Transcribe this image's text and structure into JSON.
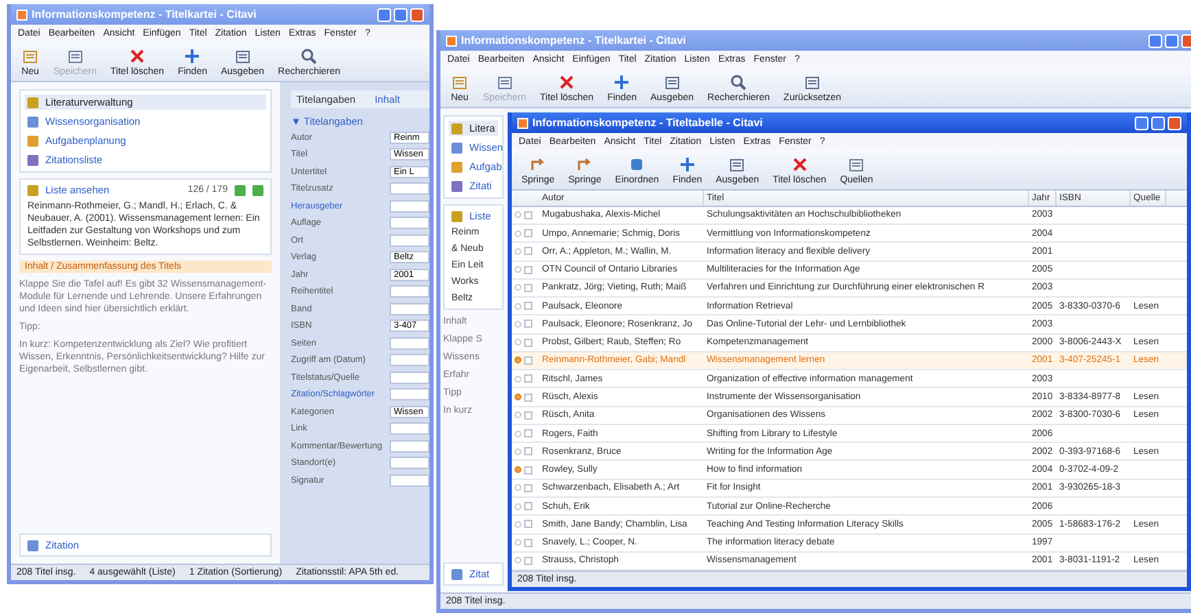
{
  "windows": [
    {
      "title": "Informationskompetenz - Titelkartei - Citavi",
      "active": false,
      "menu": [
        "Datei",
        "Bearbeiten",
        "Ansicht",
        "Einfügen",
        "Titel",
        "Zitation",
        "Listen",
        "Extras",
        "Fenster",
        "?"
      ],
      "toolbar": [
        {
          "label": "Neu",
          "kind": "new",
          "disabled": false
        },
        {
          "label": "Speichern",
          "kind": "save",
          "disabled": true
        },
        {
          "label": "Titel löschen",
          "kind": "delete",
          "disabled": false
        },
        {
          "label": "Finden",
          "kind": "find",
          "disabled": false
        },
        {
          "label": "Ausgeben",
          "kind": "output",
          "disabled": false
        },
        {
          "label": "Recherchieren",
          "kind": "search",
          "disabled": false
        }
      ],
      "nav": [
        {
          "label": "Literaturverwaltung",
          "selected": true
        },
        {
          "label": "Wissensorganisation",
          "selected": false
        },
        {
          "label": "Aufgabenplanung",
          "selected": false
        },
        {
          "label": "Zitationsliste",
          "selected": false
        }
      ],
      "list_bar": {
        "label": "Liste ansehen",
        "counter": "126 / 179"
      },
      "citation": "Reinmann-Rothmeier, G.; Mandl, H.; Erlach, C. & Neubauer, A. (2001). Wissensmanagement lernen: Ein Leitfaden zur Gestaltung von Workshops und zum Selbstlernen. Weinheim: Beltz.",
      "abstract_title": "Inhalt / Zusammenfassung des Titels",
      "abstract": "Klappe Sie die Tafel auf! Es gibt 32 Wissensmanagement-Module für Lernende und Lehrende. Unsere Erfahrungen und Ideen sind hier übersichtlich erklärt.",
      "tip": "Tipp:",
      "tip_text": "In kurz: Kompetenzentwicklung als Ziel? Wie profitiert Wissen, Erkenntnis, Persönlichkeitsentwicklung? Hilfe zur Eigenarbeit, Selbstlernen gibt.",
      "bottom_link": "Zitation",
      "details": {
        "heading": "Titelangaben",
        "link": "Inhalt",
        "group_marker": "▼",
        "group": "Titelangaben",
        "fields": [
          {
            "label": "Autor",
            "value": "Reinm",
            "link": false
          },
          {
            "label": "Titel",
            "value": "Wissen",
            "link": false
          },
          {
            "label": "Untertitel",
            "value": "Ein L",
            "link": false
          },
          {
            "label": "Titelzusatz",
            "link": false
          },
          {
            "label": "Herausgeber",
            "link": true
          },
          {
            "label": "Auflage",
            "link": false
          },
          {
            "label": "Ort",
            "link": false
          },
          {
            "label": "Verlag",
            "value": "Beltz",
            "link": false
          },
          {
            "label": "Jahr",
            "value": "2001",
            "link": false
          },
          {
            "label": "Reihentitel",
            "link": false
          },
          {
            "label": "Band",
            "link": false
          },
          {
            "label": "ISBN",
            "value": "3-407",
            "link": false
          },
          {
            "label": "Seiten",
            "link": false
          },
          {
            "label": "Zugriff am (Datum)",
            "link": false
          },
          {
            "label": "Titelstatus/Quelle",
            "link": false
          },
          {
            "label": "Zitation/Schlagwörter",
            "link": true
          },
          {
            "label": "Kategorien",
            "value": "Wissen",
            "link": false
          },
          {
            "label": "Link",
            "link": false
          },
          {
            "label": "Kommentar/Bewertung",
            "link": false
          },
          {
            "label": "Standort(e)",
            "link": false
          },
          {
            "label": "Signatur",
            "link": false
          }
        ]
      },
      "status": [
        "208 Titel insg.",
        "4 ausgewählt (Liste)",
        "1 Zitation (Sortierung)",
        "Zitationsstil: APA 5th ed."
      ]
    },
    {
      "title": "Informationskompetenz - Titelkartei - Citavi",
      "active": false,
      "menu": [
        "Datei",
        "Bearbeiten",
        "Ansicht",
        "Einfügen",
        "Titel",
        "Zitation",
        "Listen",
        "Extras",
        "Fenster",
        "?"
      ],
      "toolbar": [
        {
          "label": "Neu",
          "kind": "new",
          "disabled": false
        },
        {
          "label": "Speichern",
          "kind": "save",
          "disabled": true
        },
        {
          "label": "Titel löschen",
          "kind": "delete",
          "disabled": false
        },
        {
          "label": "Finden",
          "kind": "find",
          "disabled": false
        },
        {
          "label": "Ausgeben",
          "kind": "output",
          "disabled": false
        },
        {
          "label": "Recherchieren",
          "kind": "search",
          "disabled": false
        },
        {
          "label": "Zurücksetzen",
          "kind": "reset",
          "disabled": false
        }
      ],
      "nav": [
        {
          "label": "Litera",
          "selected": true
        },
        {
          "label": "Wissen",
          "selected": false
        },
        {
          "label": "Aufgab",
          "selected": false
        },
        {
          "label": "Zitati",
          "selected": false
        }
      ],
      "list_bar": {
        "label": "Liste"
      },
      "citation_lines": [
        "Reinm",
        "& Neub",
        "Ein Leit",
        "Works",
        "Beltz"
      ],
      "abstract_lines": [
        "Inhalt",
        "Klappe S",
        "Wissens",
        "Erfahr",
        "Tipp",
        "In kurz"
      ],
      "bottom_link": "Zitat",
      "status": [
        "208 Titel insg."
      ]
    },
    {
      "title": "Informationskompetenz - Titeltabelle - Citavi",
      "active": true,
      "menu": [
        "Datei",
        "Bearbeiten",
        "Ansicht",
        "Titel",
        "Zitation",
        "Listen",
        "Extras",
        "Fenster",
        "?"
      ],
      "toolbar": [
        {
          "label": "Springe",
          "kind": "back",
          "disabled": false
        },
        {
          "label": "Springe",
          "kind": "forward",
          "disabled": false
        },
        {
          "label": "Einordnen",
          "kind": "sort",
          "disabled": false
        },
        {
          "label": "Finden",
          "kind": "find",
          "disabled": false
        },
        {
          "label": "Ausgeben",
          "kind": "output",
          "disabled": false
        },
        {
          "label": "Titel löschen",
          "kind": "delete",
          "disabled": false
        },
        {
          "label": "Quellen",
          "kind": "sources",
          "disabled": false
        }
      ],
      "table": {
        "columns": [
          "Autor",
          "Titel",
          "Jahr",
          "ISBN",
          "Quelle"
        ],
        "rows": [
          {
            "marked": false,
            "selected": false,
            "cells": [
              "Mugabushaka, Alexis-Michel",
              "Schulungsaktivitäten an Hochschulbibliotheken",
              "2003",
              "",
              ""
            ]
          },
          {
            "marked": false,
            "selected": false,
            "cells": [
              "Umpo, Annemarie; Schmig, Doris",
              "Vermittlung von Informationskompetenz",
              "2004",
              "",
              ""
            ]
          },
          {
            "marked": false,
            "selected": false,
            "cells": [
              "Orr, A.; Appleton, M.; Wallin, M.",
              "Information literacy and flexible delivery",
              "2001",
              "",
              ""
            ]
          },
          {
            "marked": false,
            "selected": false,
            "cells": [
              "OTN Council of Ontario Libraries",
              "Multiliteracies for the Information Age",
              "2005",
              "",
              ""
            ]
          },
          {
            "marked": false,
            "selected": false,
            "cells": [
              "Pankratz, Jörg; Vieting, Ruth; Maiß",
              "Verfahren und Einrichtung zur Durchführung einer elektronischen R",
              "2003",
              "",
              ""
            ]
          },
          {
            "marked": false,
            "selected": false,
            "cells": [
              "Paulsack, Eleonore",
              "Information Retrieval",
              "2005",
              "3-8330-0370-6",
              "Lesen"
            ]
          },
          {
            "marked": false,
            "selected": false,
            "cells": [
              "Paulsack, Eleonore; Rosenkranz, Jo",
              "Das Online-Tutorial der Lehr- und Lernbibliothek",
              "2003",
              "",
              ""
            ]
          },
          {
            "marked": false,
            "selected": false,
            "cells": [
              "Probst, Gilbert; Raub, Steffen; Ro",
              "Kompetenzmanagement",
              "2000",
              "3-8006-2443-X",
              "Lesen"
            ]
          },
          {
            "marked": true,
            "selected": true,
            "cells": [
              "Reinmann-Rothmeier, Gabi; Mandl",
              "Wissensmanagement lernen",
              "2001",
              "3-407-25245-1",
              "Lesen"
            ]
          },
          {
            "marked": false,
            "selected": false,
            "cells": [
              "Ritschl, James",
              "Organization of effective information management",
              "2003",
              "",
              ""
            ]
          },
          {
            "marked": true,
            "selected": false,
            "cells": [
              "Rüsch, Alexis",
              "Instrumente der Wissensorganisation",
              "2010",
              "3-8334-8977-8",
              "Lesen"
            ]
          },
          {
            "marked": false,
            "selected": false,
            "cells": [
              "Rüsch, Anita",
              "Organisationen des Wissens",
              "2002",
              "3-8300-7030-6",
              "Lesen"
            ]
          },
          {
            "marked": false,
            "selected": false,
            "cells": [
              "Rogers, Faith",
              "Shifting from Library to Lifestyle",
              "2006",
              "",
              ""
            ]
          },
          {
            "marked": false,
            "selected": false,
            "cells": [
              "Rosenkranz, Bruce",
              "Writing for the Information Age",
              "2002",
              "0-393-97168-6",
              "Lesen"
            ]
          },
          {
            "marked": true,
            "selected": false,
            "cells": [
              "Rowley, Sully",
              "How to find information",
              "2004",
              "0-3702-4-09-2",
              ""
            ]
          },
          {
            "marked": false,
            "selected": false,
            "cells": [
              "Schwarzenbach, Elisabeth A.; Art",
              "Fit for Insight",
              "2001",
              "3-930265-18-3",
              ""
            ]
          },
          {
            "marked": false,
            "selected": false,
            "cells": [
              "Schuh, Erik",
              "Tutorial zur Online-Recherche",
              "2006",
              "",
              ""
            ]
          },
          {
            "marked": false,
            "selected": false,
            "cells": [
              "Smith, Jane Bandy; Chamblin, Lisa",
              "Teaching And Testing Information Literacy Skills",
              "2005",
              "1-58683-176-2",
              "Lesen"
            ]
          },
          {
            "marked": false,
            "selected": false,
            "cells": [
              "Snavely, L.; Cooper, N.",
              "The information literacy debate",
              "1997",
              "",
              ""
            ]
          },
          {
            "marked": false,
            "selected": false,
            "cells": [
              "Strauss, Christoph",
              "Wissensmanagement",
              "2001",
              "3-8031-1191-2",
              "Lesen"
            ]
          }
        ]
      },
      "status": [
        "208 Titel insg."
      ]
    }
  ]
}
